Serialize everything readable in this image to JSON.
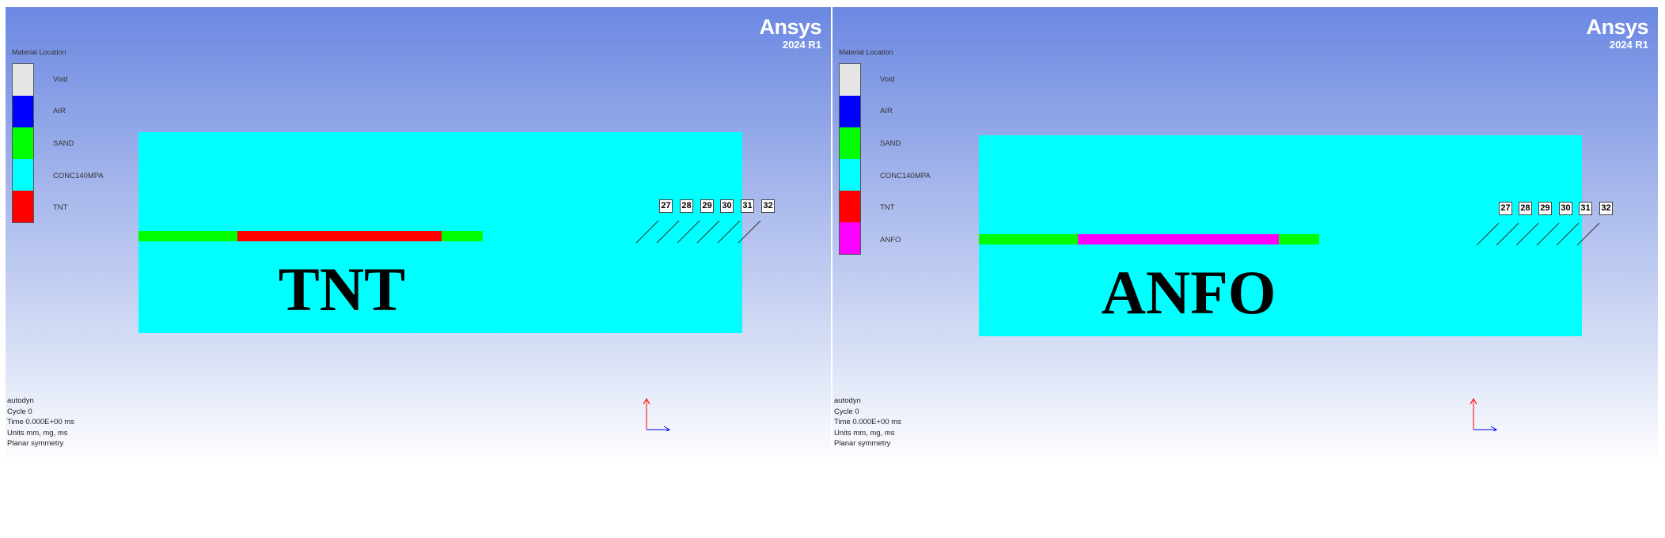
{
  "panels": [
    {
      "brand": {
        "name": "Ansys",
        "version": "2024 R1"
      },
      "legend": {
        "title": "Material Location",
        "items": [
          {
            "label": "Void",
            "color": "#e6e6e6"
          },
          {
            "label": "AIR",
            "color": "#0000ff"
          },
          {
            "label": "SAND",
            "color": "#00ff00"
          },
          {
            "label": "CONC140MPA",
            "color": "#00ffff"
          },
          {
            "label": "TNT",
            "color": "#ff0000"
          }
        ]
      },
      "charge_label": "TNT",
      "charge_color": "#ff0000",
      "gauges": [
        "27",
        "28",
        "29",
        "30",
        "31",
        "32"
      ],
      "info": [
        "autodyn",
        "Cycle 0",
        "Time 0.000E+00 ms",
        "Units mm, mg, ms",
        "Planar symmetry"
      ]
    },
    {
      "brand": {
        "name": "Ansys",
        "version": "2024 R1"
      },
      "legend": {
        "title": "Material Location",
        "items": [
          {
            "label": "Void",
            "color": "#e6e6e6"
          },
          {
            "label": "AIR",
            "color": "#0000ff"
          },
          {
            "label": "SAND",
            "color": "#00ff00"
          },
          {
            "label": "CONC140MPA",
            "color": "#00ffff"
          },
          {
            "label": "TNT",
            "color": "#ff0000"
          },
          {
            "label": "ANFO",
            "color": "#ff00ff"
          }
        ]
      },
      "charge_label": "ANFO",
      "charge_color": "#ff00ff",
      "gauges": [
        "27",
        "28",
        "29",
        "30",
        "31",
        "32"
      ],
      "info": [
        "autodyn",
        "Cycle 0",
        "Time 0.000E+00 ms",
        "Units mm, mg, ms",
        "Planar symmetry"
      ]
    }
  ],
  "colors": {
    "concrete": "#00ffff",
    "sand": "#00ff00",
    "axis_y": "#ff0000",
    "axis_x": "#0000ff"
  }
}
